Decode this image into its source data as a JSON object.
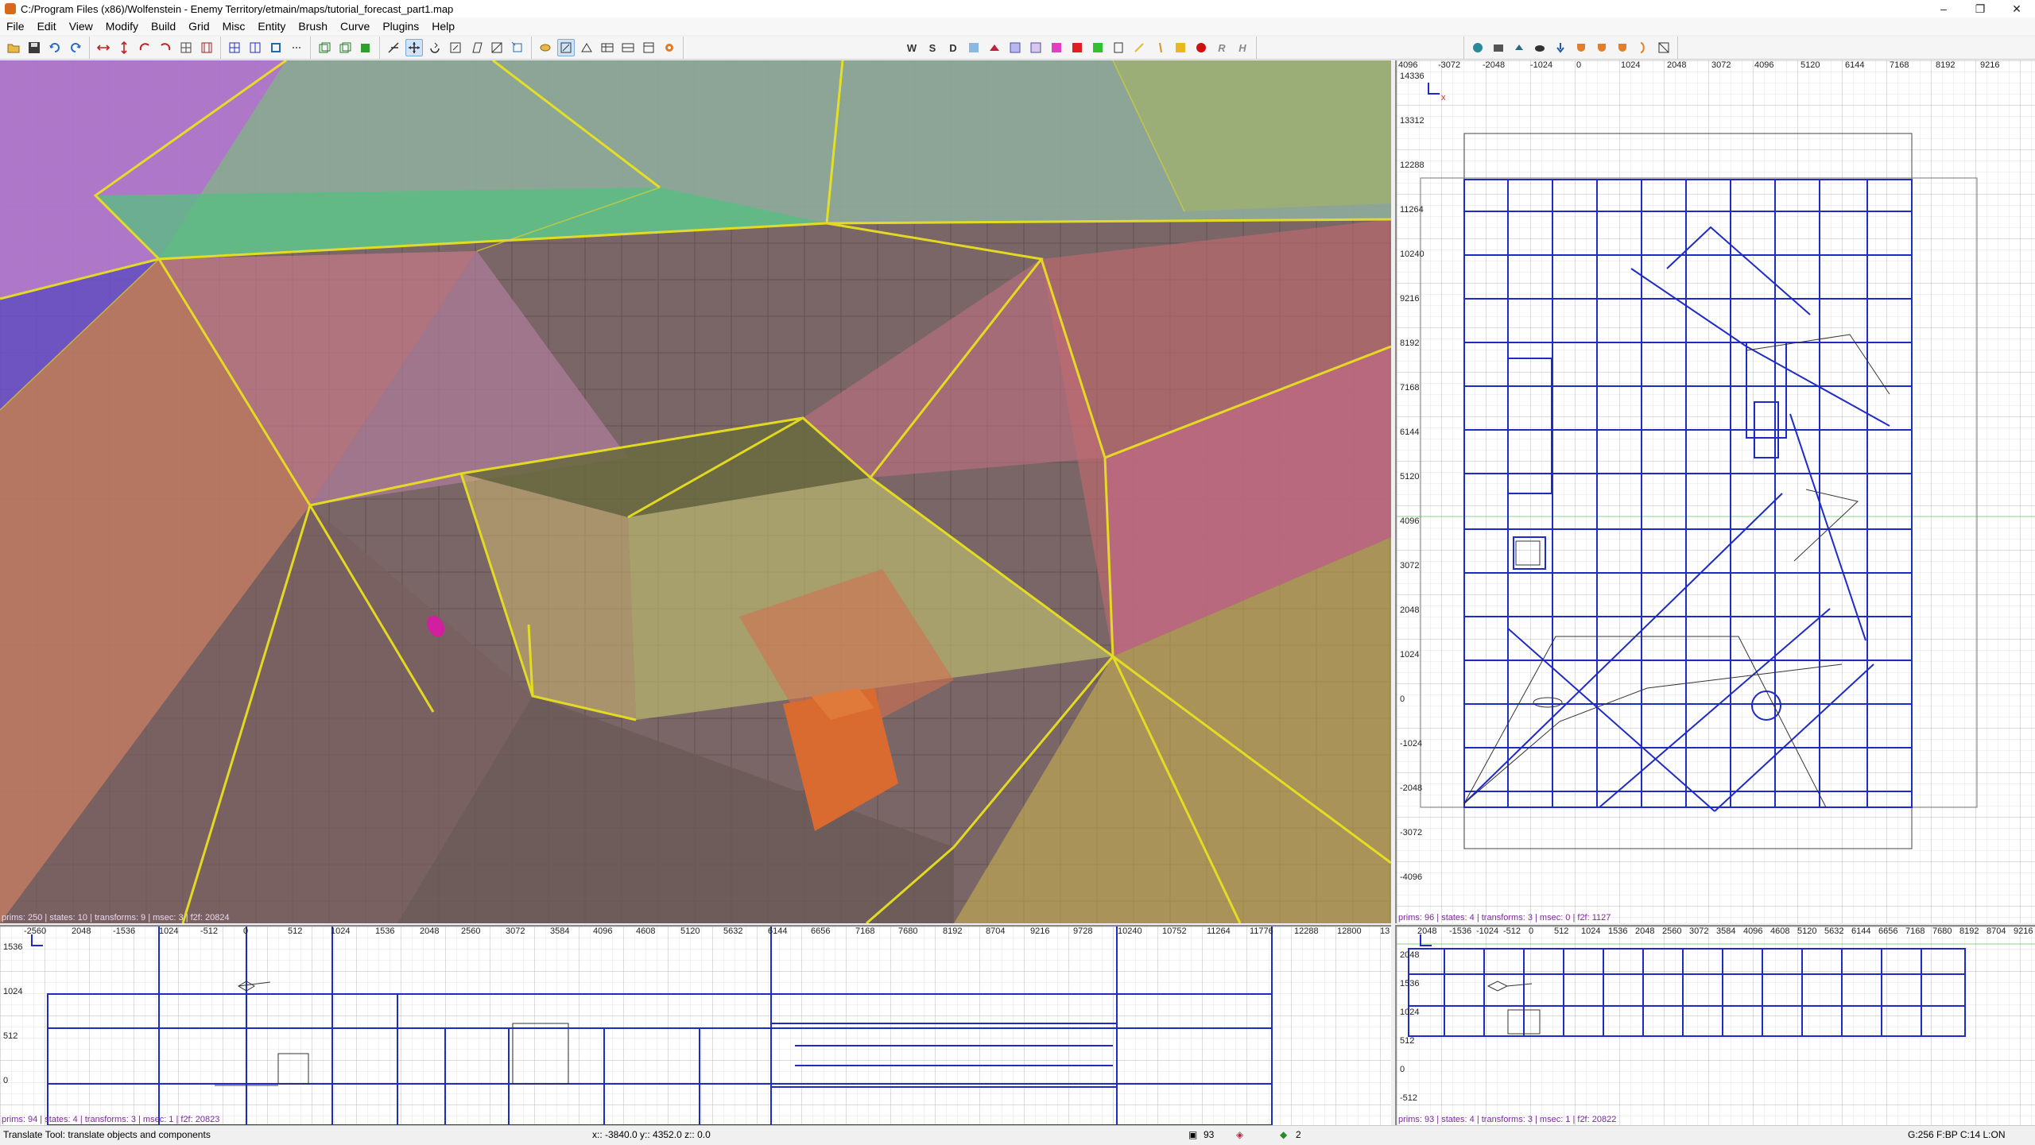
{
  "window": {
    "title": "C:/Program Files (x86)/Wolfenstein - Enemy Territory/etmain/maps/tutorial_forecast_part1.map",
    "minimize": "–",
    "maximize": "❐",
    "close": "✕"
  },
  "menu": [
    "File",
    "Edit",
    "View",
    "Modify",
    "Build",
    "Grid",
    "Misc",
    "Entity",
    "Brush",
    "Curve",
    "Plugins",
    "Help"
  ],
  "toolbar": {
    "letters": {
      "w": "W",
      "s": "S",
      "d": "D",
      "r": "R",
      "h": "H"
    }
  },
  "viewports": {
    "camera": {
      "status": "prims: 250 | states: 10 | transforms: 9 | msec: 3 | f2f: 20824"
    },
    "xy": {
      "status": "prims: 96 | states: 4 | transforms: 3 | msec: 0 | f2f: 1127",
      "h_ticks": [
        "4096",
        "-3072",
        "-2048",
        "-1024",
        "0",
        "1024",
        "2048",
        "3072",
        "4096",
        "5120",
        "6144",
        "7168",
        "8192",
        "9216"
      ],
      "v_ticks": [
        "14336",
        "13312",
        "12288",
        "11264",
        "10240",
        "9216",
        "8192",
        "7168",
        "6144",
        "5120",
        "4096",
        "3072",
        "2048",
        "1024",
        "0",
        "-1024",
        "-2048",
        "-3072",
        "-4096"
      ]
    },
    "xz": {
      "status": "prims: 94 | states: 4 | transforms: 3 | msec: 1 | f2f: 20823",
      "h_ticks": [
        "-2560",
        "2048",
        "-1536",
        "1024",
        "-512",
        "0",
        "512",
        "1024",
        "1536",
        "2048",
        "2560",
        "3072",
        "3584",
        "4096",
        "4608",
        "5120",
        "5632",
        "6144",
        "6656",
        "7168",
        "7680",
        "8192",
        "8704",
        "9216",
        "9728",
        "10240",
        "10752",
        "11264",
        "11776",
        "12288",
        "12800",
        "13"
      ],
      "v_ticks": [
        "1536",
        "1024",
        "512",
        "0"
      ]
    },
    "yz": {
      "status": "prims: 93 | states: 4 | transforms: 3 | msec: 1 | f2f: 20822",
      "h_ticks": [
        "2048",
        "-1536",
        "-1024",
        "-512",
        "0",
        "512",
        "1024",
        "1536",
        "2048",
        "2560",
        "3072",
        "3584",
        "4096",
        "4608",
        "5120",
        "5632",
        "6144",
        "6656",
        "7168",
        "7680",
        "8192",
        "8704",
        "9216"
      ],
      "v_ticks": [
        "2048",
        "1536",
        "1024",
        "512",
        "0",
        "-512"
      ]
    }
  },
  "statusbar": {
    "tool": "Translate Tool: translate objects and components",
    "coords": "x:: -3840.0  y:: 4352.0  z::     0.0",
    "brush_count": "93",
    "entity_count": "2",
    "grid": "G:256  F:BP  C:14  L:ON"
  },
  "colors": {
    "accent_brush": "#1e2bc4",
    "edge_highlight": "#e8e020",
    "status_purple": "#7a2a9a"
  }
}
